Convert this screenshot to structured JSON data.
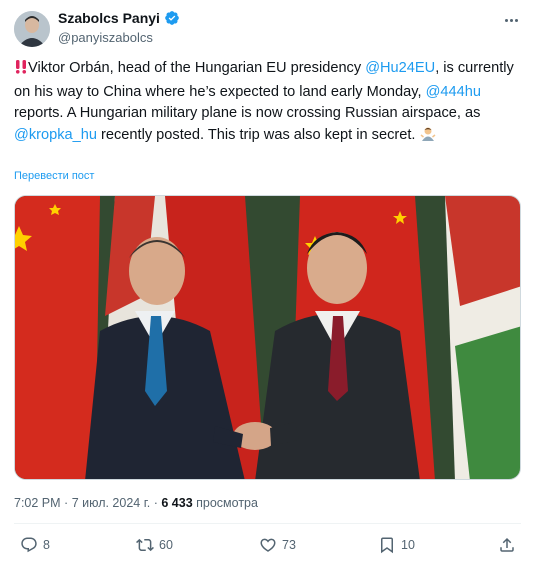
{
  "author": {
    "name": "Szabolcs Panyi",
    "handle": "@panyiszabolcs",
    "verified": true
  },
  "tweet": {
    "text_1": "Viktor Orbán, head of the Hungarian EU presidency ",
    "mention_1": "@Hu24EU",
    "text_2": ", is currently on his way to China where he’s expected to land early Monday, ",
    "mention_2": "@444hu",
    "text_3": " reports. A Hungarian military plane is now crossing Russian airspace, as ",
    "mention_3": "@kropka_hu",
    "text_4": " recently posted. This trip was also kept in secret."
  },
  "translate_label": "Перевести пост",
  "meta": {
    "time": "7:02 PM",
    "date": "7 июл. 2024 г.",
    "views_count": "6 433",
    "views_label": "просмотра"
  },
  "actions": {
    "replies": "8",
    "reposts": "60",
    "likes": "73",
    "bookmarks": "10"
  },
  "colors": {
    "accent": "#1d9bf0",
    "text": "#0f1419",
    "muted": "#536471"
  }
}
